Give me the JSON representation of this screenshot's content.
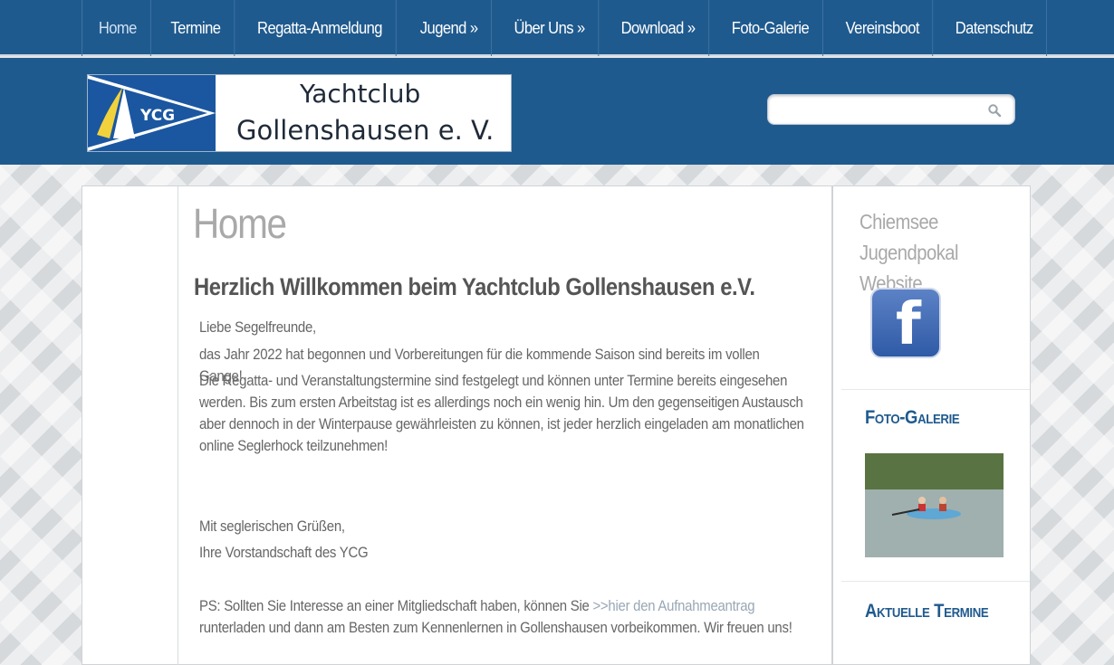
{
  "nav": {
    "items": [
      {
        "label": "Home"
      },
      {
        "label": "Termine"
      },
      {
        "label": "Regatta-Anmeldung"
      },
      {
        "label": "Jugend »"
      },
      {
        "label": "Über Uns »"
      },
      {
        "label": "Download »"
      },
      {
        "label": "Foto-Galerie"
      },
      {
        "label": "Vereinsboot"
      },
      {
        "label": "Datenschutz"
      }
    ]
  },
  "header": {
    "logo_badge": "YCG",
    "logo_line1": "Yachtclub",
    "logo_line2": "Gollenshausen e. V.",
    "search_placeholder": ""
  },
  "main": {
    "title": "Home",
    "welcome": "Herzlich Willkommen beim Yachtclub Gollenshausen e.V.",
    "greeting": "Liebe Segelfreunde,",
    "p1": "das Jahr 2022 hat begonnen und Vorbereitungen für die kommende Saison sind bereits im vollen Gange!",
    "p2": "Die Regatta- und Veranstaltungstermine sind festgelegt und können unter Termine bereits eingesehen werden. Bis zum ersten Arbeitstag ist es allerdings noch ein wenig hin. Um den gegenseitigen Austausch aber dennoch in der Winterpause gewährleisten zu können, ist jeder herzlich eingeladen am monatlichen online Seglerhock teilzunehmen!",
    "closing1": "Mit seglerischen Grüßen,",
    "closing2": "Ihre Vorstandschaft des YCG",
    "ps_before": "PS: Sollten Sie Interesse an einer Mitgliedschaft haben, können Sie ",
    "ps_link": ">>hier den Aufnahmeantrag",
    "ps_after": " runterladen und dann am Besten zum Kennenlernen in Gollenshausen vorbeikommen. Wir freuen uns!"
  },
  "sidebar": {
    "link": "Chiemsee Jugendpokal Website",
    "fb_letter": "f",
    "gallery_heading": "Foto-Galerie",
    "termine_heading": "Aktuelle Termine"
  }
}
